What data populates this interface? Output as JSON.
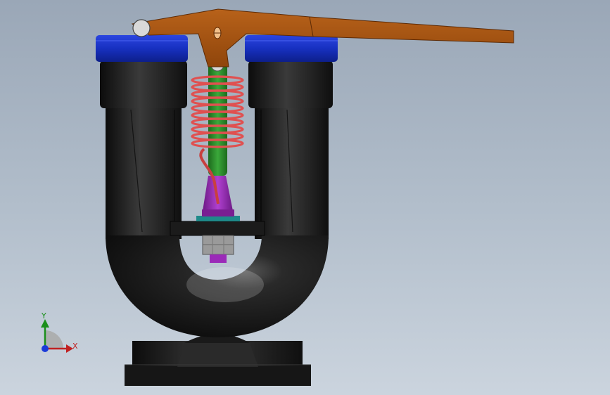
{
  "viewport": {
    "background_top": "#9aa7b7",
    "background_bottom": "#cbd4de"
  },
  "model": {
    "body_color": "#1e1e1e",
    "cap_color": "#1a33c8",
    "lever_color": "#a8550f",
    "spring_color": "#e05050",
    "stem_color": "#2f8a2f",
    "bracket_color": "#9b2ab8",
    "nut_color": "#9a9a9a",
    "seat_color": "#1f8a8a"
  },
  "triad": {
    "x_label": "X",
    "y_label": "Y",
    "x_color": "#c02020",
    "y_color": "#1b8f1b",
    "z_color": "#1a3ad8"
  }
}
